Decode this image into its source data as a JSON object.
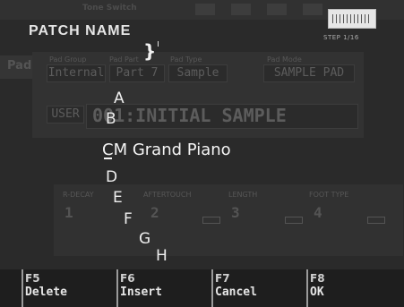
{
  "header": {
    "title": "PATCH NAME",
    "step": "STEP 1/16",
    "keyboard_icon": "keyboard-icon"
  },
  "background": {
    "tab_title": "Tone Switch",
    "pad_tab": "Pad",
    "pad_group_label": "Pad Group",
    "pad_part_label": "Pad Part",
    "pad_type_label": "Pad Type",
    "pad_mode_label": "Pad Mode",
    "pad_group": "Internal",
    "pad_part": "Part 7",
    "pad_type": "Sample",
    "pad_mode": "SAMPLE PAD",
    "user": "USER",
    "sample_name": "001:INITIAL SAMPLE",
    "sub_labels": [
      "R-DECAY",
      "AFTERTOUCH",
      "LENGTH",
      "FOOT TYPE"
    ],
    "sub_values": [
      "1",
      "2",
      "3",
      "4"
    ]
  },
  "name_entry": {
    "above_char": "}",
    "characters": [
      "A",
      "B",
      "C",
      "D",
      "E",
      "F",
      "G",
      "H"
    ],
    "current_name": "CM Grand Piano"
  },
  "function_keys": [
    {
      "key": "F5",
      "label": "Delete"
    },
    {
      "key": "F6",
      "label": "Insert"
    },
    {
      "key": "F7",
      "label": "Cancel"
    },
    {
      "key": "F8",
      "label": "OK"
    }
  ]
}
